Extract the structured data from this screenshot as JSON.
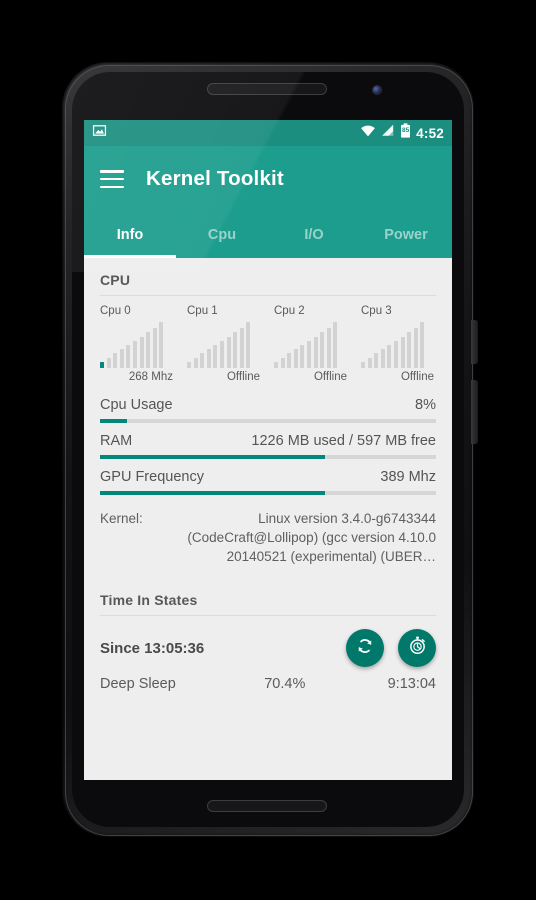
{
  "status_bar": {
    "notification_icon": "image-notification-icon",
    "wifi_icon": "wifi-icon",
    "signal_icon": "cell-signal-icon",
    "battery_icon": "battery-icon",
    "battery_level": "85",
    "time": "4:52"
  },
  "app_bar": {
    "menu_icon": "hamburger-menu-icon",
    "title": "Kernel Toolkit"
  },
  "tabs": [
    {
      "label": "Info",
      "active": true
    },
    {
      "label": "Cpu",
      "active": false
    },
    {
      "label": "I/O",
      "active": false
    },
    {
      "label": "Power",
      "active": false
    }
  ],
  "cpu_section": {
    "header": "CPU",
    "cores": [
      {
        "name": "Cpu 0",
        "status": "268 Mhz",
        "active_step": 1
      },
      {
        "name": "Cpu 1",
        "status": "Offline",
        "active_step": 0
      },
      {
        "name": "Cpu 2",
        "status": "Offline",
        "active_step": 0
      },
      {
        "name": "Cpu 3",
        "status": "Offline",
        "active_step": 0
      }
    ]
  },
  "stats": [
    {
      "label": "Cpu Usage",
      "value": "8%",
      "percent": 8
    },
    {
      "label": "RAM",
      "value": "1226 MB used / 597 MB free",
      "percent": 67
    },
    {
      "label": "GPU Frequency",
      "value": "389 Mhz",
      "percent": 67
    }
  ],
  "kernel": {
    "label": "Kernel:",
    "text": "Linux version 3.4.0-g6743344 (CodeCraft@Lollipop) (gcc version 4.10.0 20140521 (experimental) (UBER…"
  },
  "time_in_states": {
    "header": "Time In States",
    "since": "Since 13:05:36",
    "refresh_icon": "refresh-icon",
    "timer_icon": "stopwatch-icon",
    "rows": [
      {
        "name": "Deep Sleep",
        "percent": "70.4%",
        "duration": "9:13:04"
      }
    ]
  },
  "nav_bar": {
    "back_icon": "back-triangle-icon",
    "home_icon": "home-circle-icon",
    "recents_icon": "recents-square-icon"
  },
  "colors": {
    "primary": "#1c9d8d",
    "primary_dark": "#1c8e80",
    "accent": "#00897b",
    "fab": "#00796b",
    "content_bg": "#eeeeee"
  },
  "chart_data": {
    "type": "bar",
    "title": "CPU frequency step histograms",
    "series": [
      {
        "name": "Cpu 0",
        "values": [
          6,
          10,
          14,
          18,
          22,
          26,
          30,
          34,
          38,
          44
        ],
        "active_index": 0,
        "status": "268 Mhz"
      },
      {
        "name": "Cpu 1",
        "values": [
          6,
          10,
          14,
          18,
          22,
          26,
          30,
          34,
          38,
          44
        ],
        "active_index": -1,
        "status": "Offline"
      },
      {
        "name": "Cpu 2",
        "values": [
          6,
          10,
          14,
          18,
          22,
          26,
          30,
          34,
          38,
          44
        ],
        "active_index": -1,
        "status": "Offline"
      },
      {
        "name": "Cpu 3",
        "values": [
          6,
          10,
          14,
          18,
          22,
          26,
          30,
          34,
          38,
          44
        ],
        "active_index": -1,
        "status": "Offline"
      }
    ],
    "ylabel": "",
    "xlabel": "",
    "grid": false,
    "legend": "none"
  }
}
